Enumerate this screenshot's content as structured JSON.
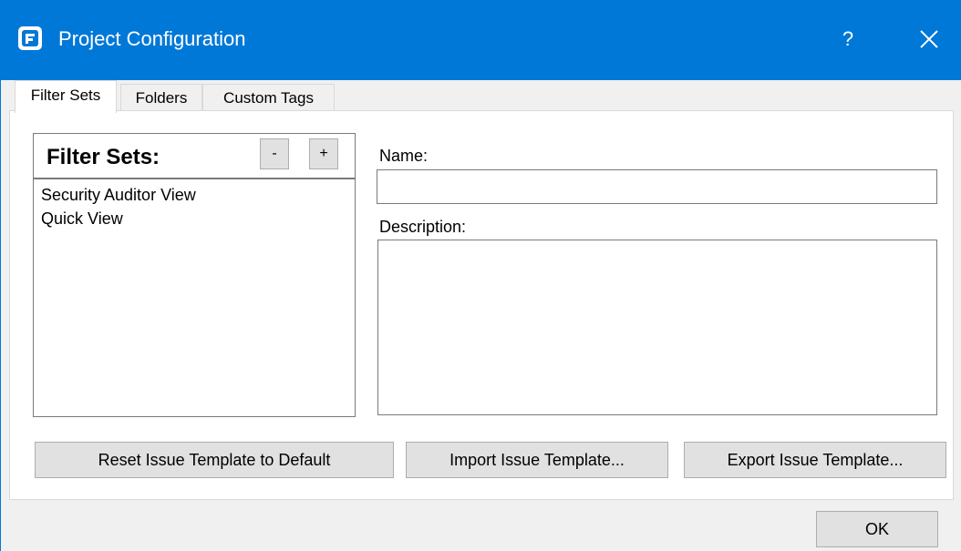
{
  "window": {
    "title": "Project Configuration",
    "help_label": "?",
    "accent_color": "#0078d7"
  },
  "tabs": [
    {
      "label": "Filter Sets",
      "active": true
    },
    {
      "label": "Folders",
      "active": false
    },
    {
      "label": "Custom Tags",
      "active": false
    }
  ],
  "filter_sets": {
    "header": "Filter Sets:",
    "remove_label": "-",
    "add_label": "+",
    "items": [
      "Security Auditor View",
      "Quick View"
    ]
  },
  "form": {
    "name_label": "Name:",
    "name_value": "",
    "description_label": "Description:",
    "description_value": ""
  },
  "actions": {
    "reset_label": "Reset Issue Template to Default",
    "import_label": "Import Issue Template...",
    "export_label": "Export Issue Template..."
  },
  "footer": {
    "ok_label": "OK"
  }
}
